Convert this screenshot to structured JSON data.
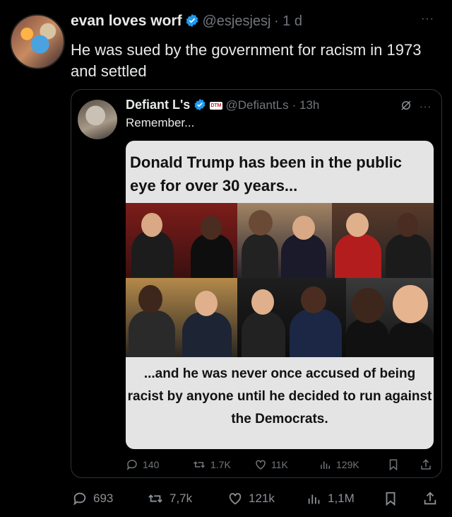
{
  "tweet": {
    "author_name": "evan loves worf",
    "handle": "@esjesjesj",
    "time": "· 1 d",
    "text": "He was sued by the government for racism in 1973 and settled",
    "more": "···"
  },
  "quote": {
    "author_name": "Defiant L's",
    "badge": "DTM",
    "handle": "@DefiantLs",
    "time": "· 13h",
    "text": "Remember...",
    "more": "···"
  },
  "meme": {
    "top_text": "Donald Trump has been in the public eye for over 30 years...",
    "bottom_text": "...and he was never once accused of being racist by anyone until he decided to run against the Democrats."
  },
  "quote_actions": {
    "replies": "140",
    "reposts": "1.7K",
    "likes": "11K",
    "views": "129K"
  },
  "tweet_actions": {
    "replies": "693",
    "reposts": "7,7k",
    "likes": "121k",
    "views": "1,1M"
  },
  "colors": {
    "background": "#000000",
    "text": "#e7e9ea",
    "muted": "#71767b",
    "verified": "#1d9bf0",
    "border": "#2f3336"
  },
  "icons": [
    "verified-icon",
    "more-icon",
    "grok-icon",
    "reply-icon",
    "repost-icon",
    "like-icon",
    "views-icon",
    "bookmark-icon",
    "share-icon"
  ]
}
